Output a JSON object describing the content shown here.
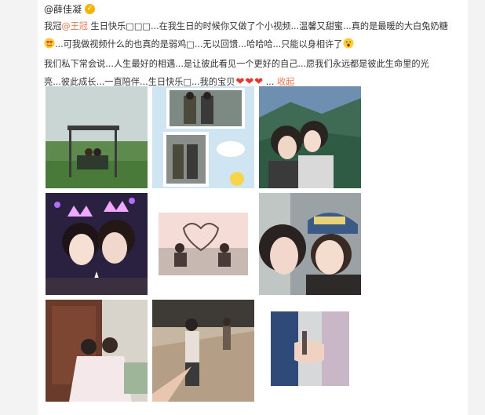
{
  "post": {
    "author": "@薛佳凝",
    "verified_badge_icon": "verified-v-badge",
    "text_prefix": "我冠",
    "mention": "@王冠",
    "text_1": " 生日快乐□□□...在我生日的时候你又做了个小视频...温馨又甜蜜...真的是最暖的大白兔奶糖",
    "text_2": "...可我做视频什么的也真的是弱鸡□...无以回馈...哈哈哈...只能以身相许了",
    "text_3": "我们私下常会说...人生最好的相遇...是让彼此看见一个更好的自己...愿我们永远都是彼此生命里的光",
    "text_4": "亮...彼此成长...一直陪伴...生日快乐□...我的宝贝",
    "collapse_label": "收起",
    "emoji_1_icon": "heart-eyes-emoji",
    "emoji_2_icon": "surprised-emoji",
    "heart_icon": "red-heart-emoji"
  },
  "photos": [
    {
      "name": "photo-swing-bench",
      "description_icon": "photo"
    },
    {
      "name": "photo-collage-couple",
      "description_icon": "photo"
    },
    {
      "name": "photo-mountain-selfie",
      "description_icon": "photo"
    },
    {
      "name": "photo-concert-crowns",
      "description_icon": "photo"
    },
    {
      "name": "photo-heart-silhouettes",
      "description_icon": "photo"
    },
    {
      "name": "photo-cap-selfie",
      "description_icon": "photo"
    },
    {
      "name": "photo-doorway-sitting",
      "description_icon": "photo"
    },
    {
      "name": "photo-street-hand",
      "description_icon": "photo"
    },
    {
      "name": "photo-holding-hands",
      "description_icon": "photo"
    }
  ]
}
